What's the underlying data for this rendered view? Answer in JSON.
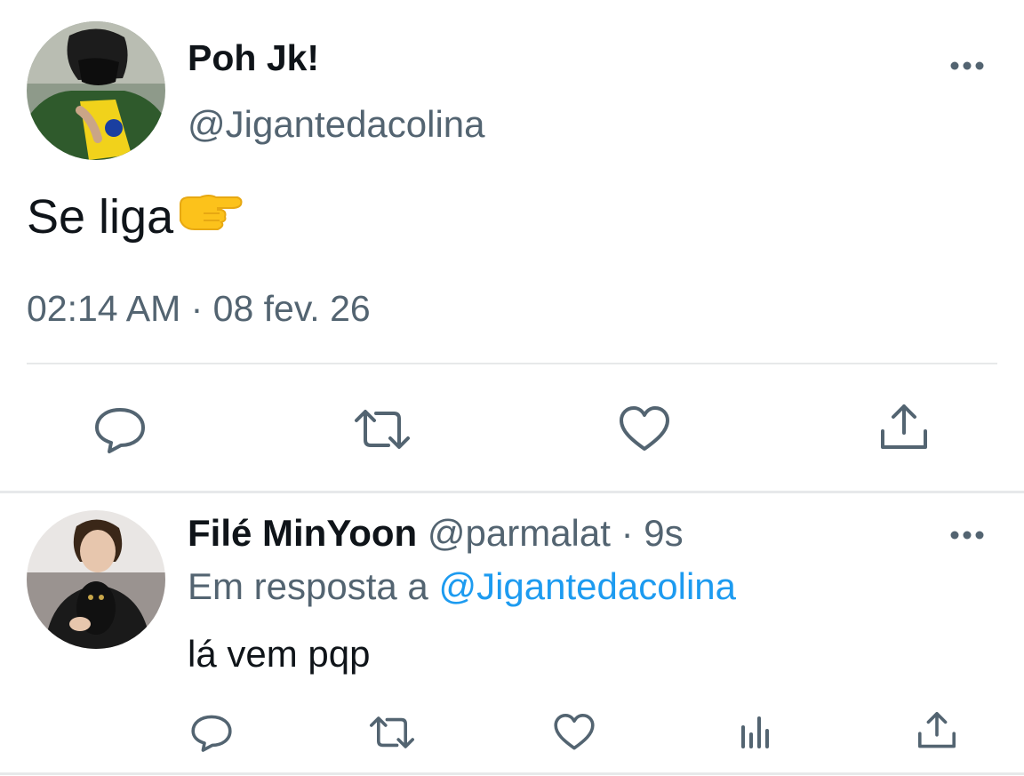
{
  "main_tweet": {
    "display_name": "Poh Jk!",
    "handle": "@Jigantedacolina",
    "text": "Se liga",
    "emoji_icon": "backhand-index-pointing-right",
    "timestamp": "02:14 AM · 08 fev. 26",
    "actions": [
      "reply-icon",
      "retweet-icon",
      "like-icon",
      "share-icon"
    ]
  },
  "reply_tweet": {
    "display_name": "Filé MinYoon",
    "handle": "@parmalat",
    "separator": " · ",
    "time_ago": "9s",
    "reply_prefix": "Em resposta a ",
    "reply_to": "@Jigantedacolina",
    "text": "lá vem pqp",
    "actions": [
      "reply-icon",
      "retweet-icon",
      "like-icon",
      "stats-icon",
      "share-icon"
    ]
  },
  "colors": {
    "text_primary": "#0f1419",
    "text_secondary": "#536471",
    "mention": "#1d9bf0",
    "divider": "#e7e9ea",
    "icon": "#536471"
  }
}
